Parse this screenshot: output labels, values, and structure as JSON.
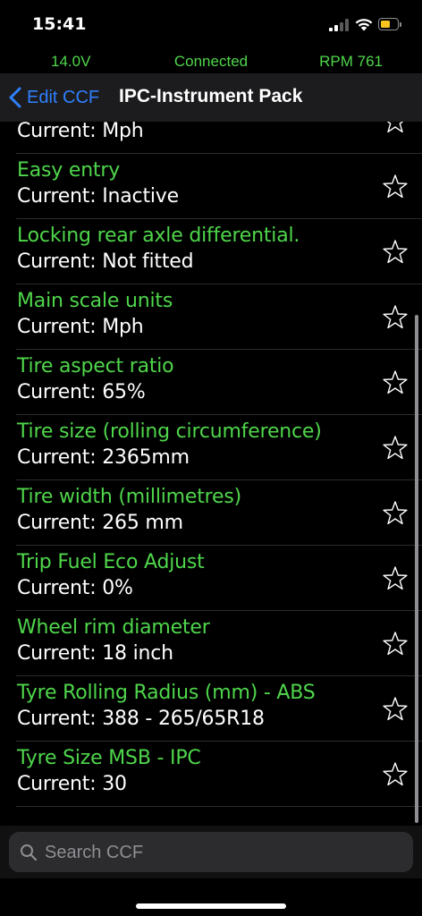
{
  "status_bar": {
    "time": "15:41"
  },
  "telemetry": {
    "voltage": "14.0V",
    "connection": "Connected",
    "rpm": "RPM 761"
  },
  "nav": {
    "back_label": "Edit CCF",
    "title": "IPC-Instrument Pack"
  },
  "items": [
    {
      "title": "",
      "value": "Current: Mph"
    },
    {
      "title": "Easy entry",
      "value": "Current: Inactive"
    },
    {
      "title": "Locking rear axle differential.",
      "value": "Current: Not fitted"
    },
    {
      "title": "Main scale units",
      "value": "Current: Mph"
    },
    {
      "title": "Tire aspect ratio",
      "value": "Current: 65%"
    },
    {
      "title": "Tire size (rolling circumference)",
      "value": "Current: 2365mm"
    },
    {
      "title": "Tire width (millimetres)",
      "value": "Current: 265 mm"
    },
    {
      "title": "Trip Fuel Eco Adjust",
      "value": "Current: 0%"
    },
    {
      "title": "Wheel rim diameter",
      "value": "Current: 18 inch"
    },
    {
      "title": "Tyre Rolling Radius (mm) - ABS",
      "value": "Current: 388 - 265/65R18"
    },
    {
      "title": "Tyre Size MSB - IPC",
      "value": "Current: 30"
    }
  ],
  "search": {
    "placeholder": "Search CCF",
    "value": ""
  },
  "colors": {
    "accent_green": "#4fd64b",
    "link_blue": "#2f80ff",
    "battery_yellow": "#f7c51e"
  },
  "icons": {
    "back": "chevron-left-icon",
    "favorite": "star-outline-icon",
    "search": "magnifier-icon"
  }
}
